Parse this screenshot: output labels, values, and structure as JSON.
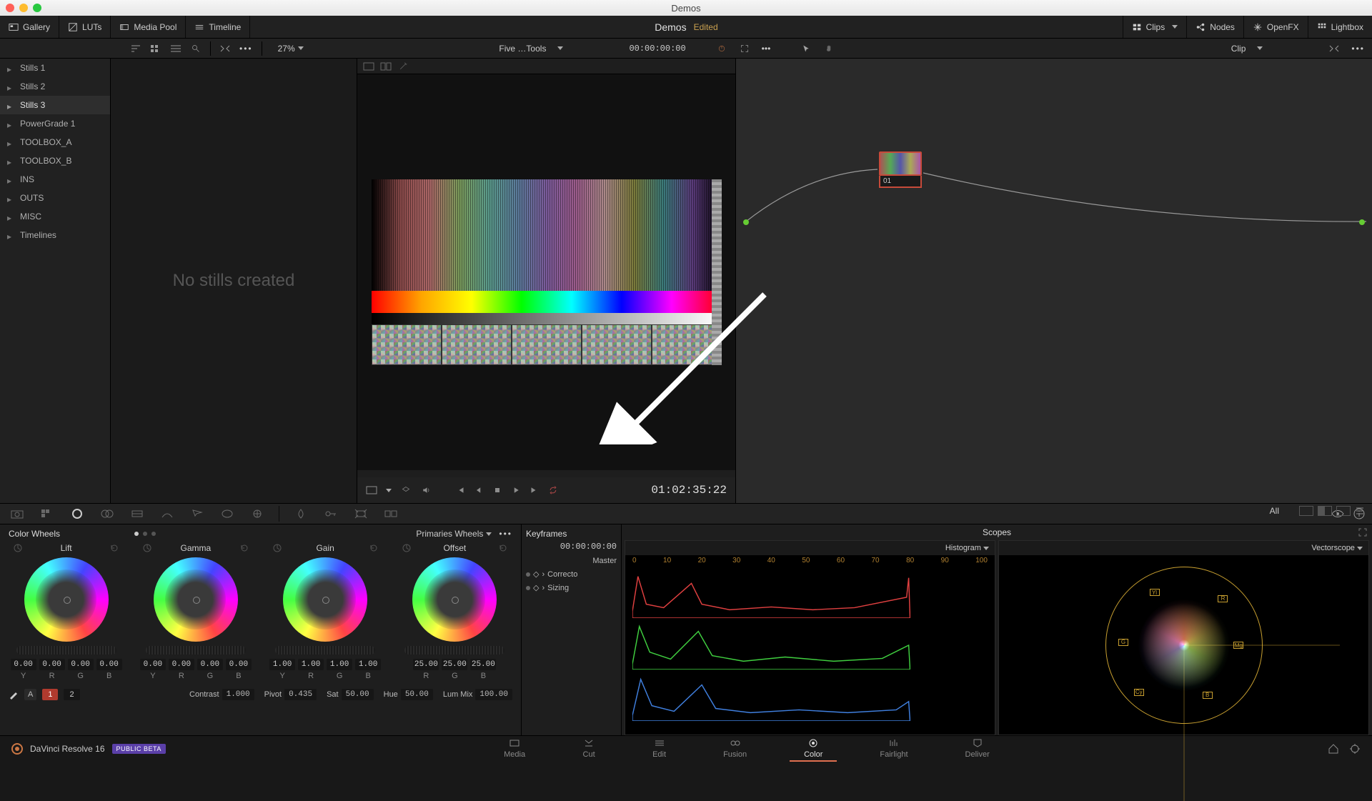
{
  "mac": {
    "title": "Demos",
    "dots": [
      "#ff5f57",
      "#febc2e",
      "#28c840"
    ]
  },
  "project": {
    "name": "Demos",
    "status": "Edited"
  },
  "toolbar": {
    "left": [
      "Gallery",
      "LUTs",
      "Media Pool",
      "Timeline"
    ],
    "right": [
      "Clips",
      "Nodes",
      "OpenFX",
      "Lightbox"
    ]
  },
  "viewerBar": {
    "zoom": "27%",
    "clipName": "Five …Tools",
    "topTimecode": "00:00:00:00",
    "clipLabel": "Clip"
  },
  "gallery": {
    "items": [
      "Stills 1",
      "Stills 2",
      "Stills 3",
      "PowerGrade 1",
      "TOOLBOX_A",
      "TOOLBOX_B",
      "INS",
      "OUTS",
      "MISC",
      "Timelines"
    ],
    "selectedIndex": 2,
    "empty": "No stills created"
  },
  "transport": {
    "timecode": "01:02:35:22"
  },
  "node": {
    "label": "01"
  },
  "colorWheels": {
    "title": "Color Wheels",
    "mode": "Primaries Wheels",
    "wheels": [
      {
        "name": "Lift",
        "vals": [
          "0.00",
          "0.00",
          "0.00",
          "0.00"
        ],
        "ch": [
          "Y",
          "R",
          "G",
          "B"
        ]
      },
      {
        "name": "Gamma",
        "vals": [
          "0.00",
          "0.00",
          "0.00",
          "0.00"
        ],
        "ch": [
          "Y",
          "R",
          "G",
          "B"
        ]
      },
      {
        "name": "Gain",
        "vals": [
          "1.00",
          "1.00",
          "1.00",
          "1.00"
        ],
        "ch": [
          "Y",
          "R",
          "G",
          "B"
        ]
      },
      {
        "name": "Offset",
        "vals": [
          "25.00",
          "25.00",
          "25.00"
        ],
        "ch": [
          "R",
          "G",
          "B"
        ]
      }
    ],
    "adjust": {
      "contrast": "1.000",
      "pivot": "0.435",
      "sat": "50.00",
      "hue": "50.00",
      "lummix": "100.00",
      "labels": {
        "contrast": "Contrast",
        "pivot": "Pivot",
        "sat": "Sat",
        "hue": "Hue",
        "lummix": "Lum Mix"
      }
    },
    "pages": [
      "1",
      "2"
    ]
  },
  "keyframes": {
    "title": "Keyframes",
    "timecode": "00:00:00:00",
    "master": "Master",
    "tracks": [
      "Correcto",
      "Sizing"
    ],
    "all": "All"
  },
  "scopes": {
    "title": "Scopes",
    "left": "Histogram",
    "right": "Vectorscope",
    "axis": [
      "0",
      "10",
      "20",
      "30",
      "40",
      "50",
      "60",
      "70",
      "80",
      "90",
      "100"
    ],
    "targets": [
      "R",
      "Mg",
      "B",
      "Cy",
      "G",
      "Yl"
    ]
  },
  "pages": {
    "appName": "DaVinci Resolve 16",
    "beta": "PUBLIC BETA",
    "tabs": [
      "Media",
      "Cut",
      "Edit",
      "Fusion",
      "Color",
      "Fairlight",
      "Deliver"
    ],
    "activeIndex": 4
  }
}
